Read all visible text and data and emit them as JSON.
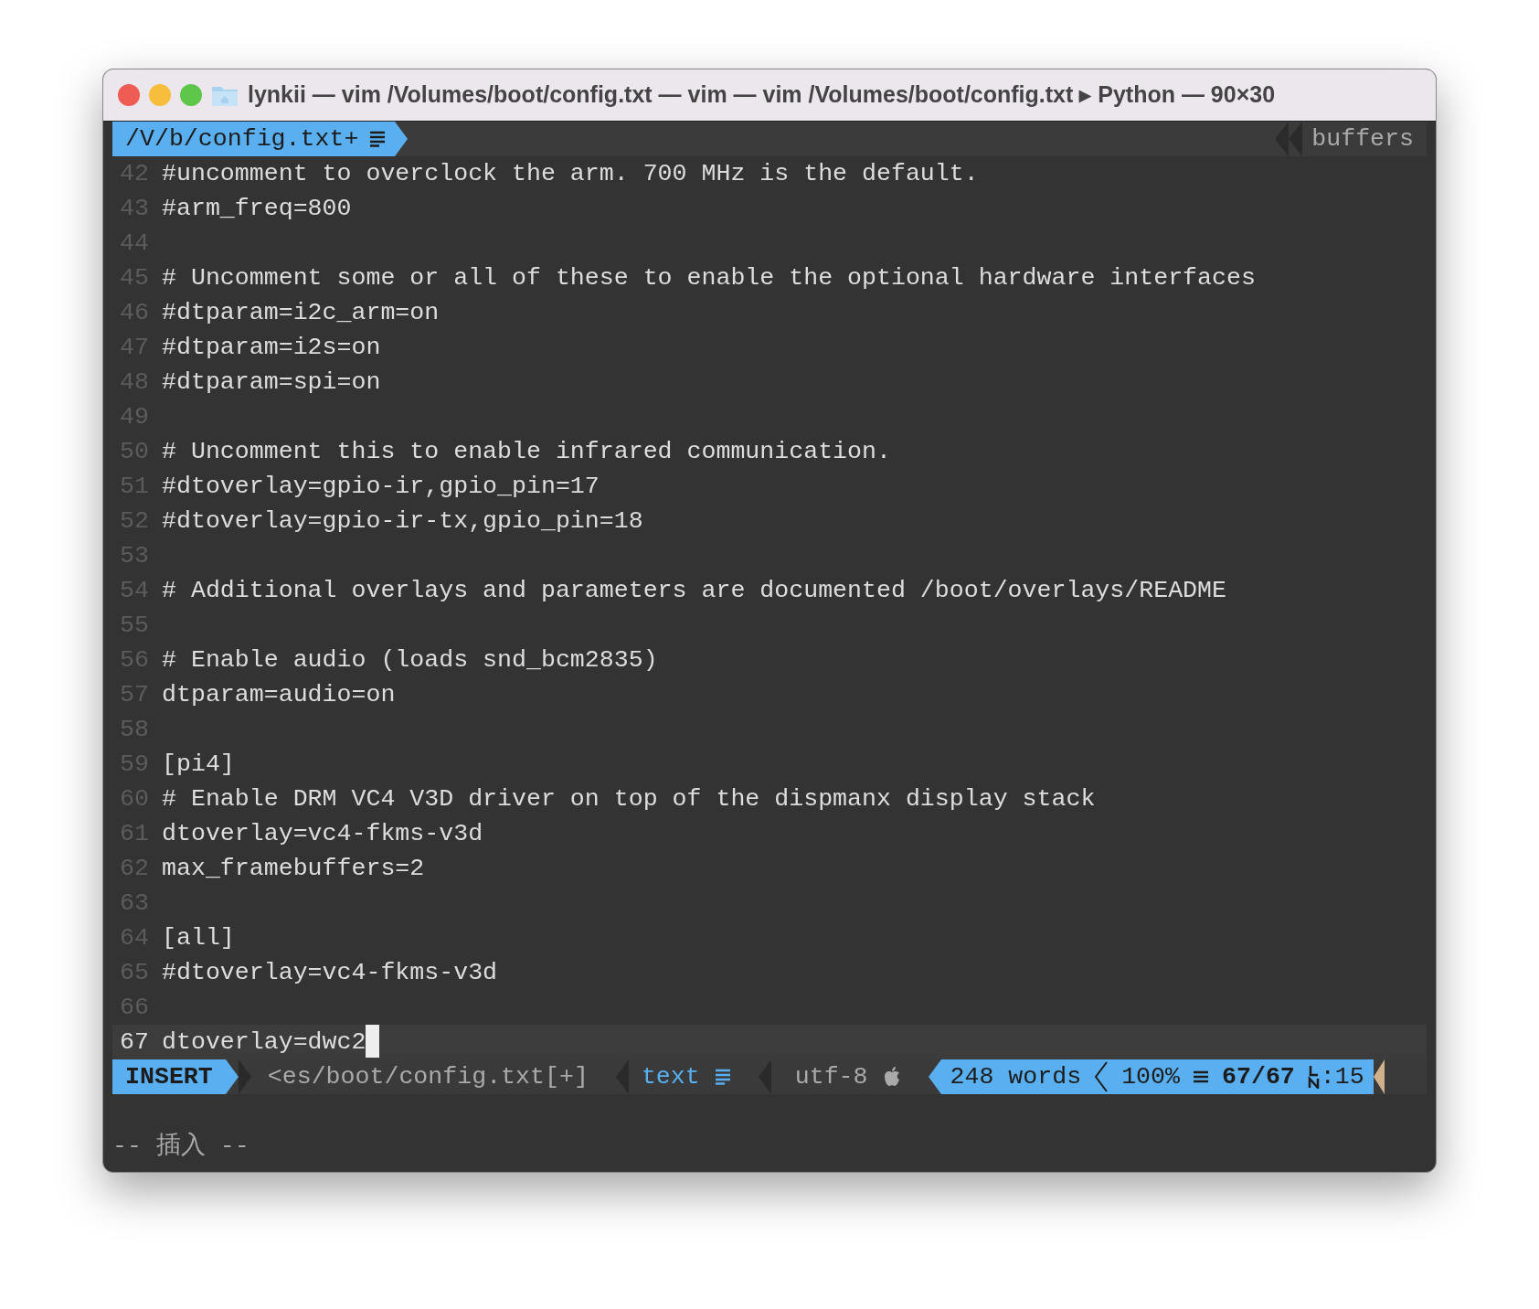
{
  "window": {
    "title": "lynkii — vim /Volumes/boot/config.txt — vim — vim /Volumes/boot/config.txt ▸ Python — 90×30"
  },
  "tabline": {
    "file": "/V/b/config.txt+",
    "buffers": "buffers"
  },
  "lines": [
    {
      "number": "42",
      "text": "#uncomment to overclock the arm. 700 MHz is the default.",
      "current": false
    },
    {
      "number": "43",
      "text": "#arm_freq=800",
      "current": false
    },
    {
      "number": "44",
      "current": false
    },
    {
      "number": "45",
      "text": "# Uncomment some or all of these to enable the optional hardware interfaces",
      "current": false
    },
    {
      "number": "46",
      "text": "#dtparam=i2c_arm=on",
      "current": false
    },
    {
      "number": "47",
      "text": "#dtparam=i2s=on",
      "current": false
    },
    {
      "number": "48",
      "text": "#dtparam=spi=on",
      "current": false
    },
    {
      "number": "49",
      "current": false
    },
    {
      "number": "50",
      "text": "# Uncomment this to enable infrared communication.",
      "current": false
    },
    {
      "number": "51",
      "text": "#dtoverlay=gpio-ir,gpio_pin=17",
      "current": false
    },
    {
      "number": "52",
      "text": "#dtoverlay=gpio-ir-tx,gpio_pin=18",
      "current": false
    },
    {
      "number": "53",
      "current": false
    },
    {
      "number": "54",
      "text": "# Additional overlays and parameters are documented /boot/overlays/README",
      "current": false
    },
    {
      "number": "55",
      "current": false
    },
    {
      "number": "56",
      "text": "# Enable audio (loads snd_bcm2835)",
      "current": false
    },
    {
      "number": "57",
      "text": "dtparam=audio=on",
      "current": false
    },
    {
      "number": "58",
      "current": false
    },
    {
      "number": "59",
      "text": "[pi4]",
      "current": false
    },
    {
      "number": "60",
      "text": "# Enable DRM VC4 V3D driver on top of the dispmanx display stack",
      "current": false
    },
    {
      "number": "61",
      "text": "dtoverlay=vc4-fkms-v3d",
      "current": false
    },
    {
      "number": "62",
      "text": "max_framebuffers=2",
      "current": false
    },
    {
      "number": "63",
      "current": false
    },
    {
      "number": "64",
      "text": "[all]",
      "current": false
    },
    {
      "number": "65",
      "text": "#dtoverlay=vc4-fkms-v3d",
      "current": false
    },
    {
      "number": "66",
      "current": false
    },
    {
      "number": "67",
      "text": "dtoverlay=dwc2",
      "current": true
    }
  ],
  "statusline": {
    "mode": "INSERT",
    "file": "<es/boot/config.txt[+]",
    "filetype": "text",
    "encoding": "utf-8",
    "words": "248 words",
    "percent": "100%",
    "position": "67/67",
    "column": ":15"
  },
  "cmdline": "-- 插入 --"
}
